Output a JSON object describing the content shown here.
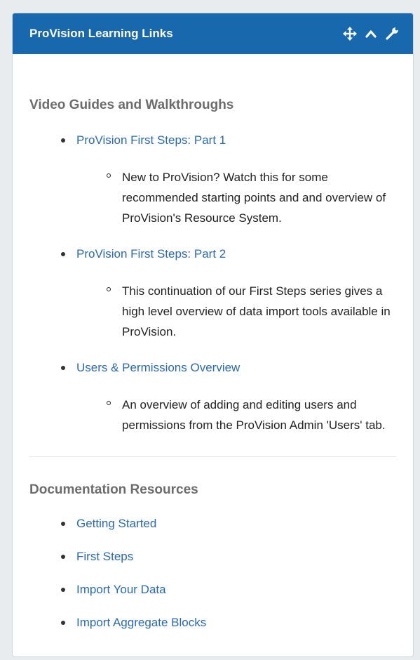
{
  "panel": {
    "title": "ProVision Learning Links",
    "header_bg": "#1868ad",
    "icons": [
      "move-icon",
      "collapse-chevron-up-icon",
      "wrench-settings-icon"
    ]
  },
  "video_section": {
    "title": "Video Guides and Walkthroughs",
    "items": [
      {
        "link": "ProVision First Steps: Part 1",
        "description": "New to ProVision? Watch this for some recommended starting points and and overview of ProVision's Resource System."
      },
      {
        "link": "ProVision First Steps: Part 2",
        "description": "This continuation of our First Steps series gives a high level overview of data import tools available in ProVision."
      },
      {
        "link": "Users & Permissions Overview",
        "description": "An overview of adding and editing users and permissions from the ProVision Admin 'Users' tab."
      }
    ]
  },
  "docs_section": {
    "title": "Documentation Resources",
    "items": [
      "Getting Started",
      "First Steps",
      "Import Your Data",
      "Import Aggregate Blocks"
    ]
  },
  "colors": {
    "link": "#2a6ab0",
    "section_title": "#6c6c6c"
  }
}
